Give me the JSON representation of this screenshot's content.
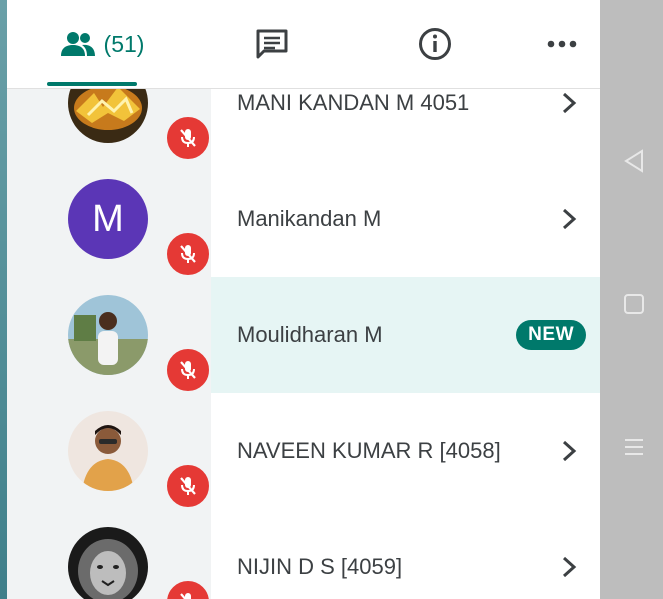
{
  "tabs": {
    "people_count": "(51)"
  },
  "participants": [
    {
      "name": "MANI KANDAN M 4051",
      "avatar": "photo-fire",
      "muted": true,
      "badge": ""
    },
    {
      "name": "Manikandan M",
      "avatar": "letter",
      "initial": "M",
      "muted": true,
      "badge": ""
    },
    {
      "name": "Moulidharan M",
      "avatar": "photo-man",
      "muted": true,
      "badge": "NEW"
    },
    {
      "name": "NAVEEN KUMAR R [4058]",
      "avatar": "photo-boy",
      "muted": true,
      "badge": ""
    },
    {
      "name": "NIJIN D S [4059]",
      "avatar": "photo-lion",
      "muted": true,
      "badge": ""
    }
  ],
  "colors": {
    "accent": "#00796b",
    "mic_muted": "#e53935",
    "avatar_letter_bg": "#5b36b6",
    "highlight_row": "#e6f5f4"
  },
  "icons": {
    "people_tab": "people-icon",
    "chat_tab": "chat-icon",
    "info_tab": "info-icon",
    "more_tab": "more-icon",
    "mic_off": "mic-off-icon",
    "chevron": "chevron-right-icon",
    "nav_back": "back-triangle-icon",
    "nav_home": "home-square-icon",
    "nav_recents": "menu-lines-icon"
  }
}
